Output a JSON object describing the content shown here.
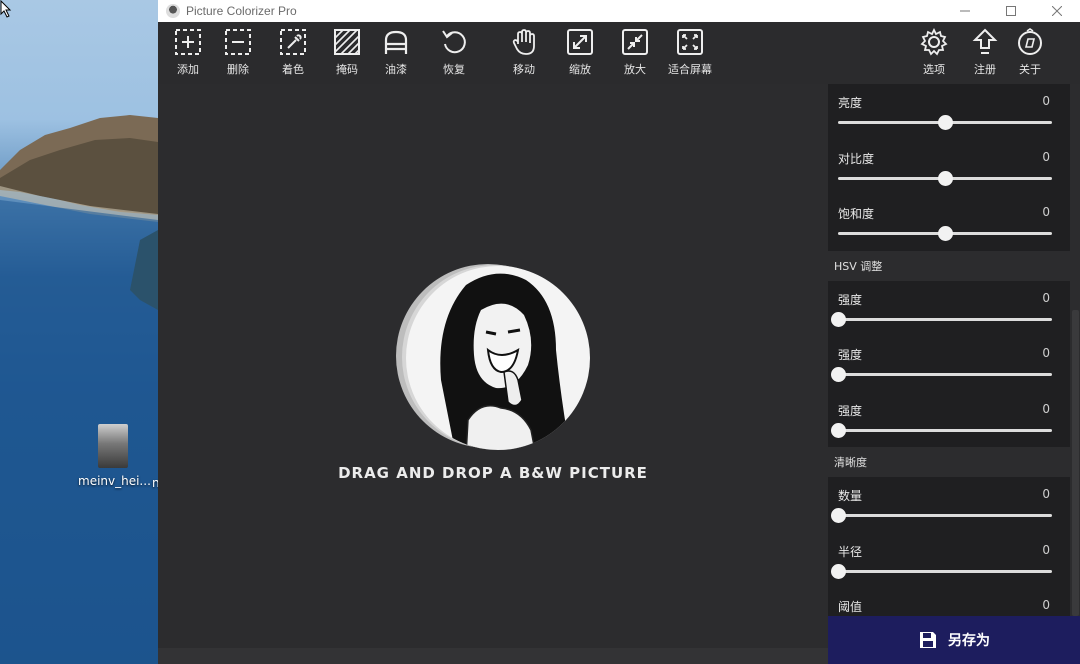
{
  "window": {
    "title": "Picture Colorizer Pro"
  },
  "desktop": {
    "file_label": "meinv_hei...",
    "extra_label": "n"
  },
  "toolbar": {
    "left": [
      {
        "label": "添加",
        "icon": "add-icon"
      },
      {
        "label": "删除",
        "icon": "remove-icon"
      },
      {
        "label": "着色",
        "icon": "dropper-icon"
      },
      {
        "label": "掩码",
        "icon": "mask-icon"
      },
      {
        "label": "油漆",
        "icon": "paint-icon"
      },
      {
        "label": "恢复",
        "icon": "undo-icon"
      },
      {
        "label": "移动",
        "icon": "hand-icon"
      },
      {
        "label": "缩放",
        "icon": "expand-icon"
      },
      {
        "label": "放大",
        "icon": "zoom-in-icon"
      },
      {
        "label": "适合屏幕",
        "icon": "fit-screen-icon"
      }
    ],
    "right": [
      {
        "label": "选项",
        "icon": "gear-icon"
      },
      {
        "label": "注册",
        "icon": "upload-arrow-icon"
      },
      {
        "label": "关于",
        "icon": "compass-icon"
      }
    ]
  },
  "canvas": {
    "drop_text": "DRAG AND DROP A B&W PICTURE"
  },
  "panel": {
    "basic": [
      {
        "label": "亮度",
        "value": "0",
        "level": 0.5
      },
      {
        "label": "对比度",
        "value": "0",
        "level": 0.5
      },
      {
        "label": "饱和度",
        "value": "0",
        "level": 0.5
      }
    ],
    "hsv_title": "HSV 调整",
    "hsv": [
      {
        "label": "强度",
        "value": "0",
        "level": 0
      },
      {
        "label": "强度",
        "value": "0",
        "level": 0
      },
      {
        "label": "强度",
        "value": "0",
        "level": 0
      }
    ],
    "sharp_title": "清晰度",
    "sharp": [
      {
        "label": "数量",
        "value": "0",
        "level": 0
      },
      {
        "label": "半径",
        "value": "0",
        "level": 0
      },
      {
        "label": "阈值",
        "value": "0",
        "level": 0
      }
    ]
  },
  "save_button": {
    "label": "另存为"
  }
}
